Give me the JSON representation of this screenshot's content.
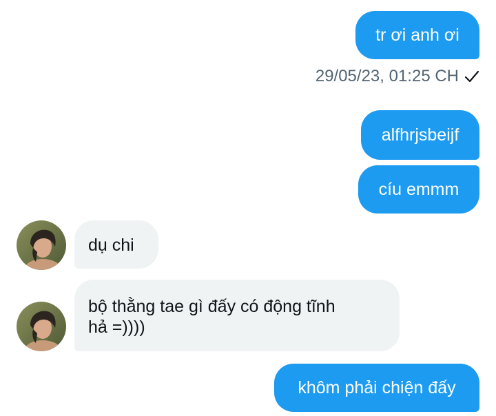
{
  "messages": {
    "msg1": {
      "text": "tr ơi anh ơi"
    },
    "msg1_status": {
      "timestamp": "29/05/23, 01:25 CH",
      "icon": "checkmark-icon"
    },
    "msg2": {
      "text": "alfhrjsbeijf"
    },
    "msg3": {
      "text": "cíu emmm"
    },
    "msg4": {
      "text": "dụ chi"
    },
    "msg5": {
      "line1": "bộ thằng tae gì đấy có động tĩnh",
      "line2": "hả =))))"
    },
    "msg6": {
      "text": "khôm phải chiện đấy"
    }
  },
  "colors": {
    "outgoing_bubble": "#1d9bf0",
    "incoming_bubble": "#eff3f4",
    "incoming_text": "#0f1419",
    "timestamp_text": "#536471"
  }
}
